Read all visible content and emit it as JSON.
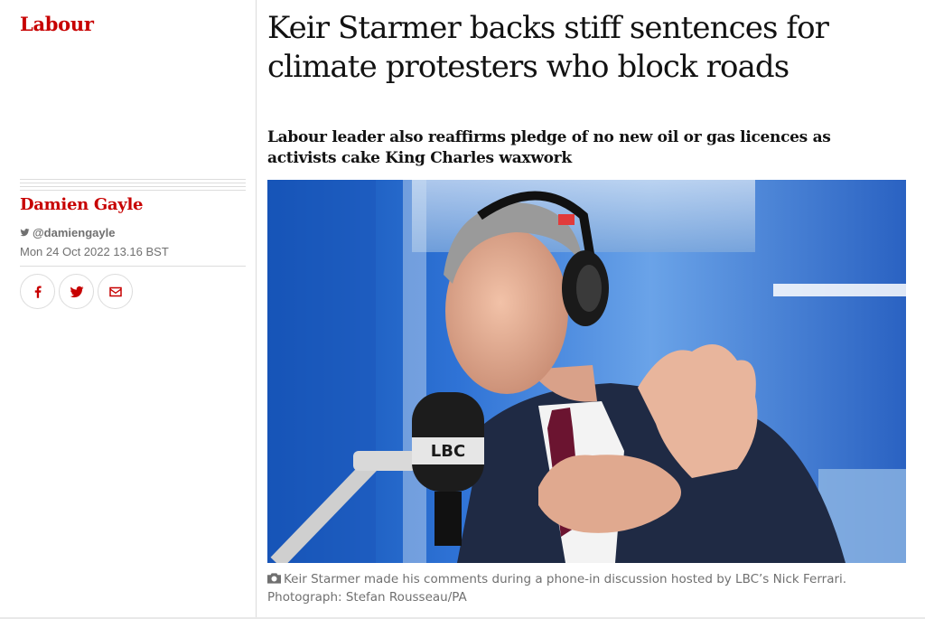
{
  "section": {
    "label": "Labour"
  },
  "byline": {
    "author": "Damien Gayle",
    "twitter": "@damiengayle",
    "date": "Mon 24 Oct 2022 13.16 BST"
  },
  "share": {
    "icons": [
      "facebook-icon",
      "twitter-icon",
      "email-icon"
    ]
  },
  "article": {
    "headline": "Keir Starmer backs stiff sentences for climate protesters who block roads",
    "standfirst": "Labour leader also reaffirms pledge of no new oil or gas licences as activists cake King Charles waxwork"
  },
  "photo": {
    "mic_brand": "LBC",
    "caption": "Keir Starmer made his comments during a phone-in discussion hosted by LBC’s Nick Ferrari.",
    "credit": "Photograph: Stefan Rousseau/PA"
  },
  "colors": {
    "brand_red": "#c70000",
    "text": "#121212",
    "muted": "#707070",
    "rule": "#dcdcdc"
  }
}
